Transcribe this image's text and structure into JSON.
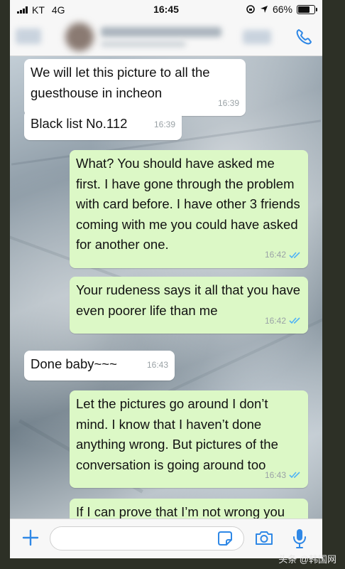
{
  "status_bar": {
    "carrier": "KT",
    "network": "4G",
    "time": "16:45",
    "battery": "66%"
  },
  "header": {
    "contact_name": "",
    "call_icon": "phone-icon"
  },
  "messages": [
    {
      "direction": "in",
      "text": "We will let this picture to all the guesthouse in incheon",
      "time": "16:39"
    },
    {
      "direction": "in",
      "text": "Black list No.112",
      "time": "16:39"
    },
    {
      "direction": "out",
      "text": "What? You should have asked me first. I have gone through the problem with card before. I have other 3 friends coming with me you could have asked for another one.",
      "time": "16:42",
      "status": "read"
    },
    {
      "direction": "out",
      "text": "Your rudeness says it all that you have even poorer life than me",
      "time": "16:42",
      "status": "read"
    },
    {
      "direction": "in",
      "text": "Done baby~~~",
      "time": "16:43"
    },
    {
      "direction": "out",
      "text": "Let the pictures go around I don’t mind. I know that I haven’t done anything wrong. But pictures of the conversation is going around too",
      "time": "16:43",
      "status": "read"
    },
    {
      "direction": "out",
      "text": "If I can prove that I’m not wrong you",
      "time": "",
      "status": ""
    }
  ],
  "input_bar": {
    "placeholder": "",
    "icons": [
      "plus-icon",
      "sticker-icon",
      "camera-icon",
      "microphone-icon"
    ]
  },
  "watermark": "头条 @韩国网",
  "colors": {
    "outgoing_bubble": "#dcf8c6",
    "incoming_bubble": "#ffffff",
    "accent": "#2f88e6",
    "read_ticks": "#4fb3f6"
  }
}
